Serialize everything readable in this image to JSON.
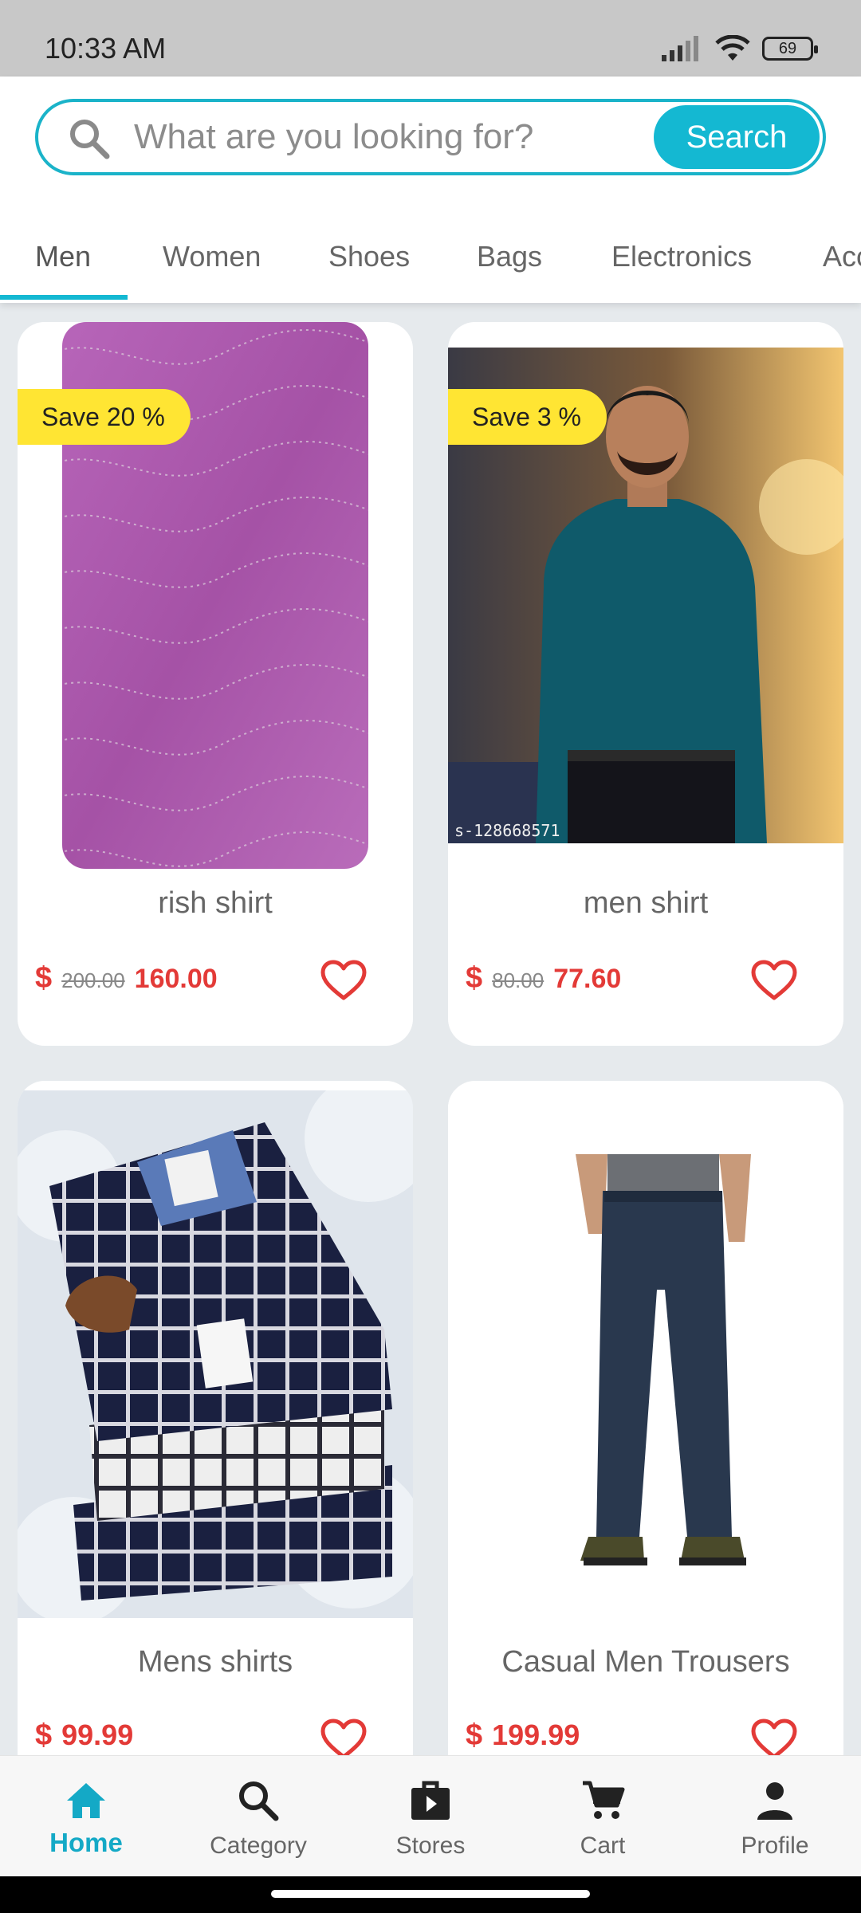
{
  "status_bar": {
    "time": "10:33 AM",
    "battery": "69"
  },
  "search": {
    "placeholder": "What are you looking for?",
    "button_label": "Search"
  },
  "tabs": [
    {
      "label": "Men",
      "active": true
    },
    {
      "label": "Women"
    },
    {
      "label": "Shoes"
    },
    {
      "label": "Bags"
    },
    {
      "label": "Electronics"
    },
    {
      "label": "Acc"
    }
  ],
  "products": [
    {
      "title": "rish shirt",
      "currency": "$",
      "old_price": "200.00",
      "price": "160.00",
      "badge": "Save 20 %",
      "image": "pink-fabric"
    },
    {
      "title": "men shirt",
      "currency": "$",
      "old_price": "80.00",
      "price": "77.60",
      "badge": "Save 3 %",
      "image": "man-teal-shirt",
      "image_caption": "s-128668571"
    },
    {
      "title": "Mens shirts",
      "currency": "$",
      "price": "99.99",
      "image": "checked-shirts-stack"
    },
    {
      "title": "Casual Men Trousers",
      "currency": "$",
      "price": "199.99",
      "image": "navy-trousers"
    }
  ],
  "bottom_nav": [
    {
      "label": "Home",
      "icon": "home-icon",
      "active": true
    },
    {
      "label": "Category",
      "icon": "search-icon"
    },
    {
      "label": "Stores",
      "icon": "store-bag-icon"
    },
    {
      "label": "Cart",
      "icon": "cart-icon"
    },
    {
      "label": "Profile",
      "icon": "person-icon"
    }
  ],
  "colors": {
    "accent": "#14b8d2",
    "price": "#e33a37",
    "badge": "#ffe533"
  }
}
